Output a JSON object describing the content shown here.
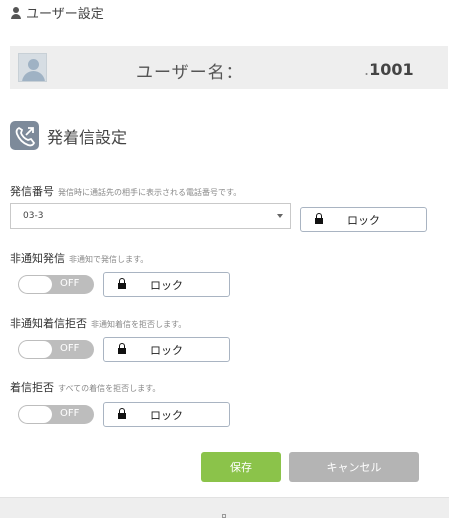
{
  "header": {
    "title": "ユーザー設定",
    "icon": "user-icon"
  },
  "user_bar": {
    "label": "ユーザー名：",
    "value_prefix": ".",
    "value": "1001",
    "avatar_icon": "avatar-placeholder"
  },
  "section": {
    "title": "発着信設定",
    "icon": "phone-forward-icon"
  },
  "caller_number": {
    "label": "発信番号",
    "hint": "発信時に通話先の相手に表示される電話番号です。",
    "selected": "03-3",
    "lock_label": "ロック"
  },
  "anonymous_call": {
    "label": "非通知発信",
    "hint": "非通知で発信します。",
    "toggle": "OFF",
    "lock_label": "ロック"
  },
  "reject_anonymous": {
    "label": "非通知着信拒否",
    "hint": "非通知着信を拒否します。",
    "toggle": "OFF",
    "lock_label": "ロック"
  },
  "reject_all": {
    "label": "着信拒否",
    "hint": "すべての着信を拒否します。",
    "toggle": "OFF",
    "lock_label": "ロック"
  },
  "actions": {
    "save": "保存",
    "cancel": "キャンセル"
  },
  "colors": {
    "save": "#8bc34a",
    "cancel": "#b4b4b4",
    "toggle_off": "#bdbdbd",
    "user_bar_bg": "#eeeeee"
  }
}
